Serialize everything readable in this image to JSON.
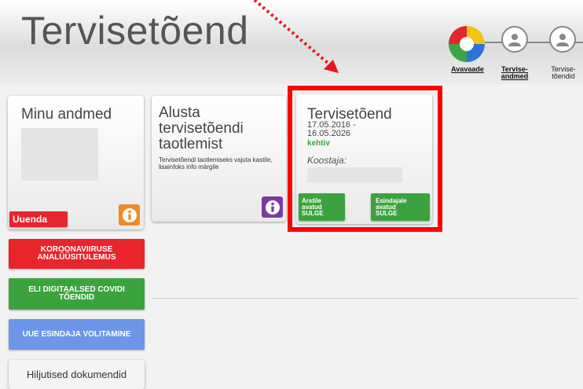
{
  "header": {
    "title": "Tervisetõend"
  },
  "nav": {
    "items": [
      {
        "label": "Avavaade",
        "active": true
      },
      {
        "label": "Tervise-\nandmed",
        "active": true
      },
      {
        "label": "Tervise-\ntõendid",
        "active": false
      }
    ]
  },
  "tiles": {
    "minu": {
      "title": "Minu andmed",
      "update_button": "Uuenda"
    },
    "alusta": {
      "title": "Alusta tervisetõendi taotlemist",
      "hint": "Tervisetõendi taotlemiseks vajuta kastile, lisainfoks info märgile"
    },
    "certificate": {
      "title": "Tervisetõend",
      "valid_range": "17.05.2016 -\n16.05.2026",
      "status": "kehtiv",
      "issuer_label": "Koostaja:",
      "doctor_button": "Arstile\navatud\nSULGE",
      "representative_button": "Esindajale\navatud\nSULGE"
    }
  },
  "side_buttons": {
    "corona": "KOROONAVIIRUSE\nANALÜÜSITULEMUS",
    "covid": "ELI DIGITAALSED COVIDI\nTÕENDID",
    "mandate": "UUE ESINDAJA VOLITAMINE",
    "recent": "Hiljutised dokumendid"
  },
  "colors": {
    "red": "#e8252c",
    "green": "#3ba33e",
    "blue": "#6c97e8",
    "orange": "#f08a24",
    "purple": "#7b3aa0",
    "highlight": "#ff0000"
  }
}
